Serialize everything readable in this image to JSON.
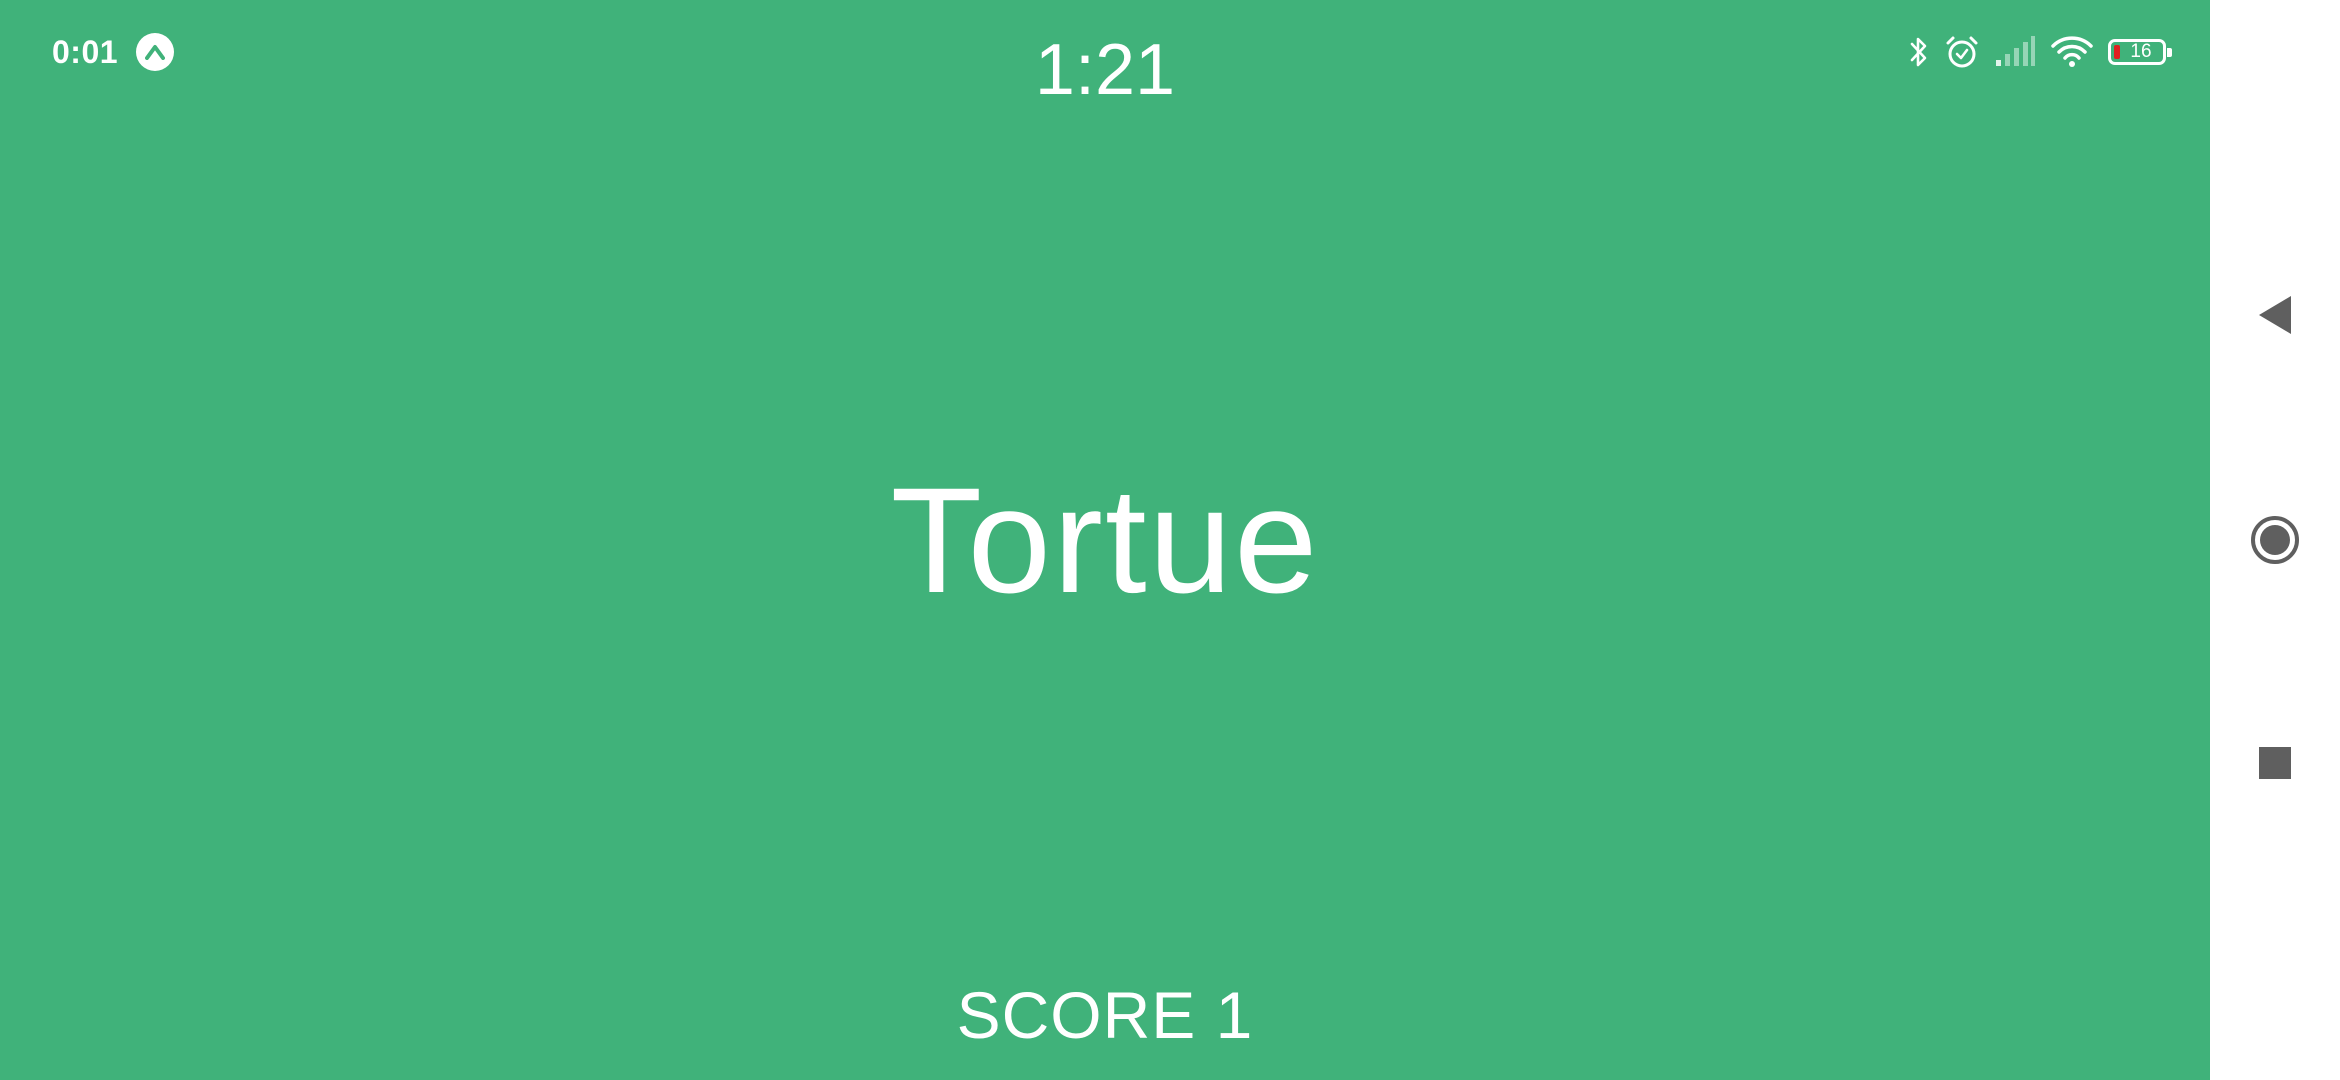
{
  "status_bar": {
    "clock": "0:01",
    "app_badge_icon": "arrow-up-icon",
    "icons": [
      "bluetooth-icon",
      "alarm-icon",
      "cellular-signal-icon",
      "wifi-icon"
    ],
    "battery_level": "16"
  },
  "game": {
    "timer": "1:21",
    "word": "Tortue",
    "score": "SCORE 1",
    "background_color": "#40b27a"
  },
  "navigation_bar": {
    "buttons": [
      "back-icon",
      "home-icon",
      "recents-icon"
    ],
    "icon_color": "#5f5f5f"
  }
}
